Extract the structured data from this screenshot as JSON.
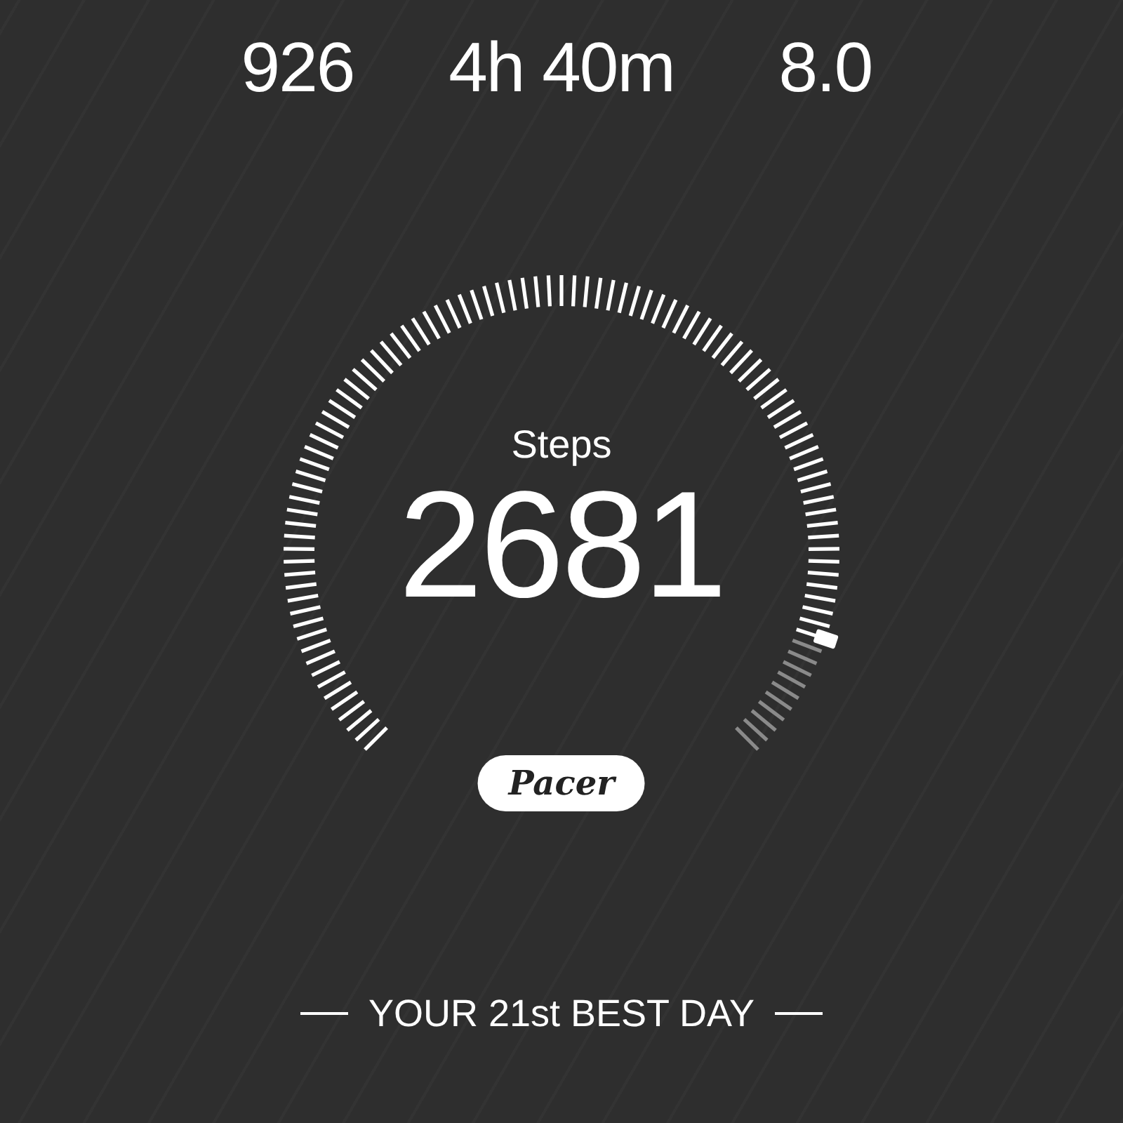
{
  "stats": [
    {
      "value": "926"
    },
    {
      "value": "4h 40m"
    },
    {
      "value": "8.0"
    }
  ],
  "steps": {
    "label": "Steps",
    "value": "2681"
  },
  "logo": "Pacer",
  "rank": "YOUR 21st BEST DAY"
}
